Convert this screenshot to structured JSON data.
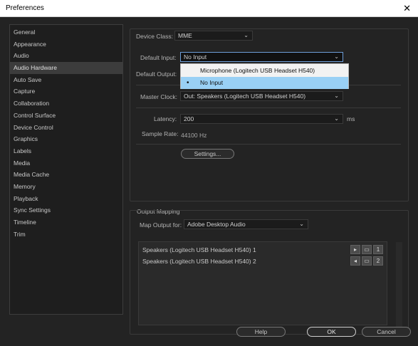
{
  "window": {
    "title": "Preferences",
    "close_glyph": "✕"
  },
  "sidebar": {
    "items": [
      {
        "label": "General"
      },
      {
        "label": "Appearance"
      },
      {
        "label": "Audio"
      },
      {
        "label": "Audio Hardware",
        "selected": true
      },
      {
        "label": "Auto Save"
      },
      {
        "label": "Capture"
      },
      {
        "label": "Collaboration"
      },
      {
        "label": "Control Surface"
      },
      {
        "label": "Device Control"
      },
      {
        "label": "Graphics"
      },
      {
        "label": "Labels"
      },
      {
        "label": "Media"
      },
      {
        "label": "Media Cache"
      },
      {
        "label": "Memory"
      },
      {
        "label": "Playback"
      },
      {
        "label": "Sync Settings"
      },
      {
        "label": "Timeline"
      },
      {
        "label": "Trim"
      }
    ]
  },
  "audio_hardware": {
    "device_class_label": "Device Class:",
    "device_class_value": "MME",
    "default_input_label": "Default Input:",
    "default_input_value": "No Input",
    "default_input_options": [
      {
        "label": "Microphone (Logitech USB Headset H540)",
        "selected": false
      },
      {
        "label": "No Input",
        "selected": true
      }
    ],
    "default_output_label": "Default Output:",
    "master_clock_label": "Master Clock:",
    "master_clock_value": "Out: Speakers (Logitech USB Headset H540)",
    "latency_label": "Latency:",
    "latency_value": "200",
    "latency_unit": "ms",
    "sample_rate_label": "Sample Rate:",
    "sample_rate_value": "44100 Hz",
    "settings_button": "Settings..."
  },
  "output_mapping": {
    "section_label": "Output Mapping",
    "map_output_label": "Map Output for:",
    "map_output_value": "Adobe Desktop Audio",
    "channels": [
      {
        "label": "Speakers (Logitech USB Headset H540) 1",
        "number": "1",
        "icon": "play-icon"
      },
      {
        "label": "Speakers (Logitech USB Headset H540) 2",
        "number": "2",
        "icon": "speaker-icon"
      }
    ]
  },
  "footer": {
    "help": "Help",
    "ok": "OK",
    "cancel": "Cancel"
  },
  "colors": {
    "background": "#232323",
    "panel": "#1e1e1e",
    "accent": "#6d9ed8",
    "dropdown_highlight": "#99d0f5"
  }
}
